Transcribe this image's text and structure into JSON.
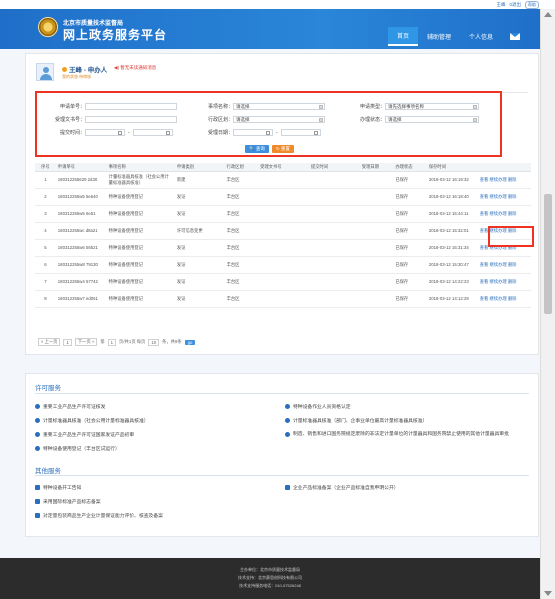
{
  "topbar": {
    "links": [
      "王峰",
      "0退出"
    ],
    "help": "帮助"
  },
  "header": {
    "org": "北京市质量技术监督局",
    "title": "网上政务服务平台",
    "nav": [
      {
        "label": "首页",
        "active": true
      },
      {
        "label": "辅助管理",
        "active": false
      },
      {
        "label": "个人信息",
        "active": false
      }
    ]
  },
  "user": {
    "name": "王峰 - 申办人",
    "sub": "我的状态:待审核",
    "notice": "暂无未读通知消息"
  },
  "search": {
    "apply_no_label": "申请单号：",
    "accept_no_label": "受理文书号：",
    "submit_time_label": "提交时间：",
    "item_name_label": "事项名称：",
    "district_label": "行政区划：",
    "accept_date_label": "受理日期：",
    "apply_type_label": "申请类型：",
    "status_label": "办理状态：",
    "please_select": "请选择",
    "apply_type_value": "请先选择事项名称",
    "query_button": "查询",
    "reset_button": "重置"
  },
  "table": {
    "columns": [
      "序号",
      "申请单号",
      "事项名称",
      "申请类别",
      "行政区划",
      "受理文书号",
      "提交时间",
      "受理日期",
      "办理状态",
      "保存时间",
      ""
    ],
    "rows": [
      {
        "no": "1",
        "apply_no": "180312255629 2d30",
        "item": "计量标准器具核准（社会公用计量标准器具核准）",
        "type": "新建",
        "district": "丰台区",
        "status": "已保存",
        "save_time": "2018-03-12 16:19:32",
        "ops": "查看 继续办理 删除"
      },
      {
        "no": "2",
        "apply_no": "180312255w5 5e640",
        "item": "特种设备使用登记",
        "type": "发证",
        "district": "丰台区",
        "status": "已保存",
        "save_time": "2018-03-12 16:18:40",
        "ops": "查看 继续办理 删除"
      },
      {
        "no": "3",
        "apply_no": "180312255w5 6e51",
        "item": "特种设备使用登记",
        "type": "发证",
        "district": "丰台区",
        "status": "已保存",
        "save_time": "2018-03-12 15:44:11",
        "ops": "查看 继续办理 删除"
      },
      {
        "no": "4",
        "apply_no": "180312255wc d8a21",
        "item": "特种设备使用登记",
        "type": "许可信息变更",
        "district": "丰台区",
        "status": "已保存",
        "save_time": "2018-03-12 15:32:01",
        "ops": "查看 继续办理 删除"
      },
      {
        "no": "5",
        "apply_no": "180312255w6 56521",
        "item": "特种设备使用登记",
        "type": "发证",
        "district": "丰台区",
        "status": "已保存",
        "save_time": "2018-03-12 15:31:34",
        "ops": "查看 继续办理 删除"
      },
      {
        "no": "6",
        "apply_no": "180312255w8 79130",
        "item": "特种设备使用登记",
        "type": "发证",
        "district": "丰台区",
        "status": "已保存",
        "save_time": "2018-03-12 15:30:47",
        "ops": "查看 继续办理 删除"
      },
      {
        "no": "7",
        "apply_no": "180312255w4 57742",
        "item": "特种设备使用登记",
        "type": "发证",
        "district": "丰台区",
        "status": "已保存",
        "save_time": "2018-03-12 14:22:23",
        "ops": "查看 继续办理 删除"
      },
      {
        "no": "8",
        "apply_no": "180312255w7 ed051",
        "item": "特种设备使用登记",
        "type": "发证",
        "district": "丰台区",
        "status": "已保存",
        "save_time": "2018-03-12 14:12:29",
        "ops": "查看 继续办理 删除"
      }
    ]
  },
  "pager": {
    "prev": "« 上一页",
    "page": "1",
    "next": "下一页 »",
    "info1": "第",
    "info2": "页/共1页 每页",
    "per_page": "10",
    "info3": "条，共8条",
    "go": "go"
  },
  "services": {
    "section1_title": "许可服务",
    "left": [
      "重要工业产品生产许可证核发",
      "计量标准器具核准（社会公用计量标准器具核准）",
      "重要工业产品生产许可证国家发证产品初审",
      "特种设备使用登记（丰台区试运行）"
    ],
    "right": [
      "特种设备作业人员资格认定",
      "计量标准器具核准（部门、企事业单位最高计量标准器具核准）",
      "制造、销售和进口国务院规定废除的非法定计量单位的计量器具和国务院禁止使用的其他计量器具审批"
    ],
    "section2_title": "其他服务",
    "other_left": [
      "特种设备开工告知",
      "采用国际标准产品标志备案",
      "对定量包装商品生产企业计量保证能力评价、核查及备案"
    ],
    "other_right": [
      "企业产品标准备案（企业产品标准自我申明公开）"
    ]
  },
  "footer": {
    "line1": "主办单位：北京市质量技术监督局",
    "line2": "技术支持：北京赛思创科技有限公司",
    "line3": "技术支持服务电话：010-57526248"
  }
}
